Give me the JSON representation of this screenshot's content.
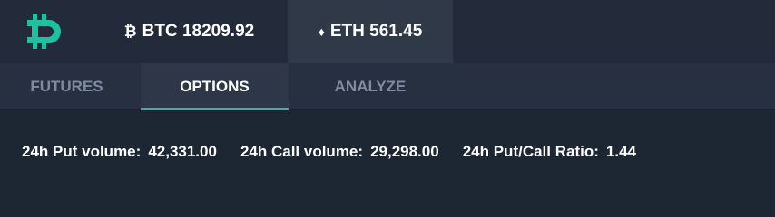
{
  "app": {
    "logo_icon": "bitcoin-logo-icon",
    "accent_color": "#21bfa0"
  },
  "tickers": [
    {
      "symbol": "₿",
      "icon": "bitcoin-icon",
      "label": "BTC 18209.92"
    },
    {
      "symbol": "♦",
      "icon": "ethereum-icon",
      "label": "ETH 561.45"
    }
  ],
  "tabs": [
    {
      "label": "FUTURES",
      "active": false
    },
    {
      "label": "OPTIONS",
      "active": true
    },
    {
      "label": "ANALYZE",
      "active": false
    }
  ],
  "stats": [
    {
      "label": "24h Put volume:",
      "value": "42,331.00"
    },
    {
      "label": "24h Call volume:",
      "value": "29,298.00"
    },
    {
      "label": "24h Put/Call Ratio:",
      "value": "1.44"
    }
  ]
}
